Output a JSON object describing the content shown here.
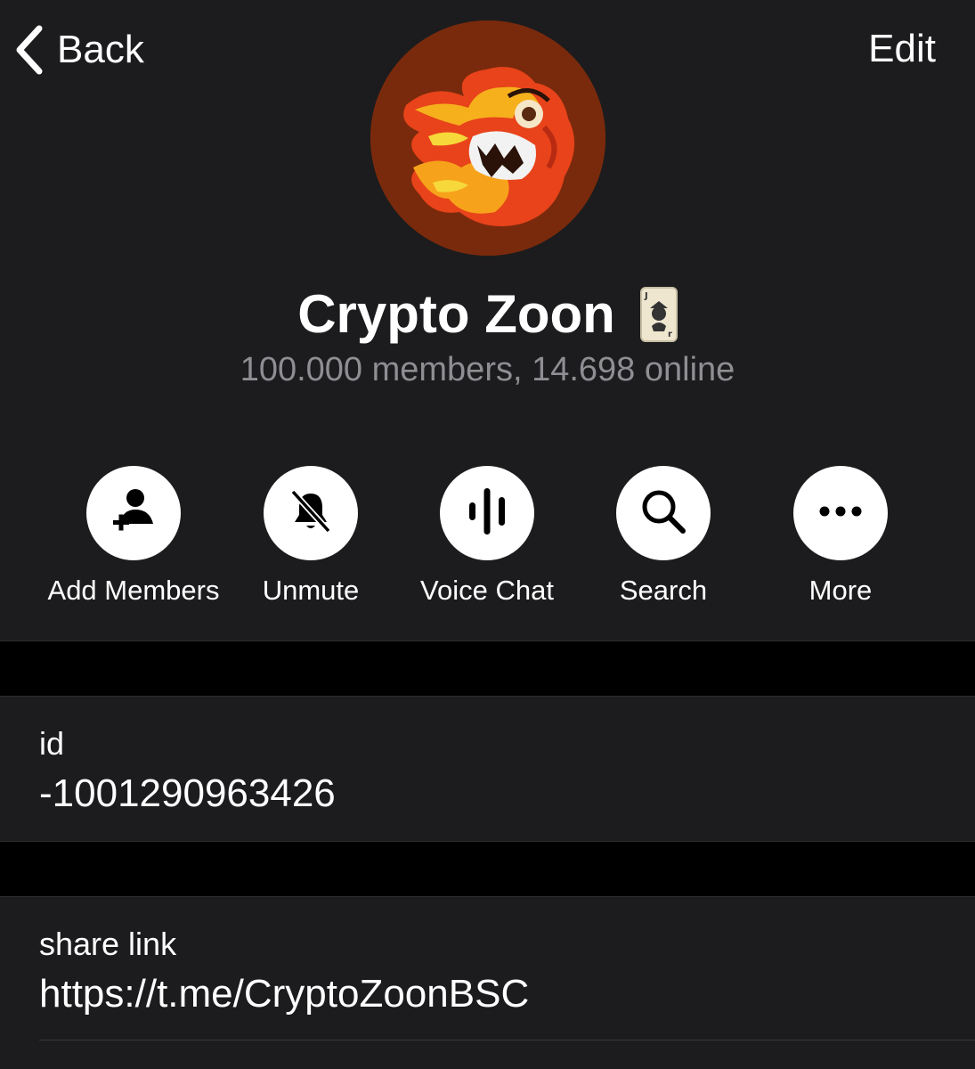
{
  "nav": {
    "back_label": "Back",
    "edit_label": "Edit"
  },
  "group": {
    "name": "Crypto Zoon",
    "members_line": "100.000 members, 14.698 online"
  },
  "actions": [
    {
      "label": "Add Members",
      "icon": "add-member-icon"
    },
    {
      "label": "Unmute",
      "icon": "bell-slash-icon"
    },
    {
      "label": "Voice Chat",
      "icon": "voice-waveform-icon"
    },
    {
      "label": "Search",
      "icon": "search-icon"
    },
    {
      "label": "More",
      "icon": "more-dots-icon"
    }
  ],
  "info": {
    "id_label": "id",
    "id_value": "-1001290963426",
    "share_label": "share link",
    "share_value": "https://t.me/CryptoZoonBSC"
  },
  "colors": {
    "background": "#000000",
    "panel": "#1c1c1e",
    "secondary_text": "#8e8e93",
    "avatar_bg": "#7a2a0c"
  }
}
